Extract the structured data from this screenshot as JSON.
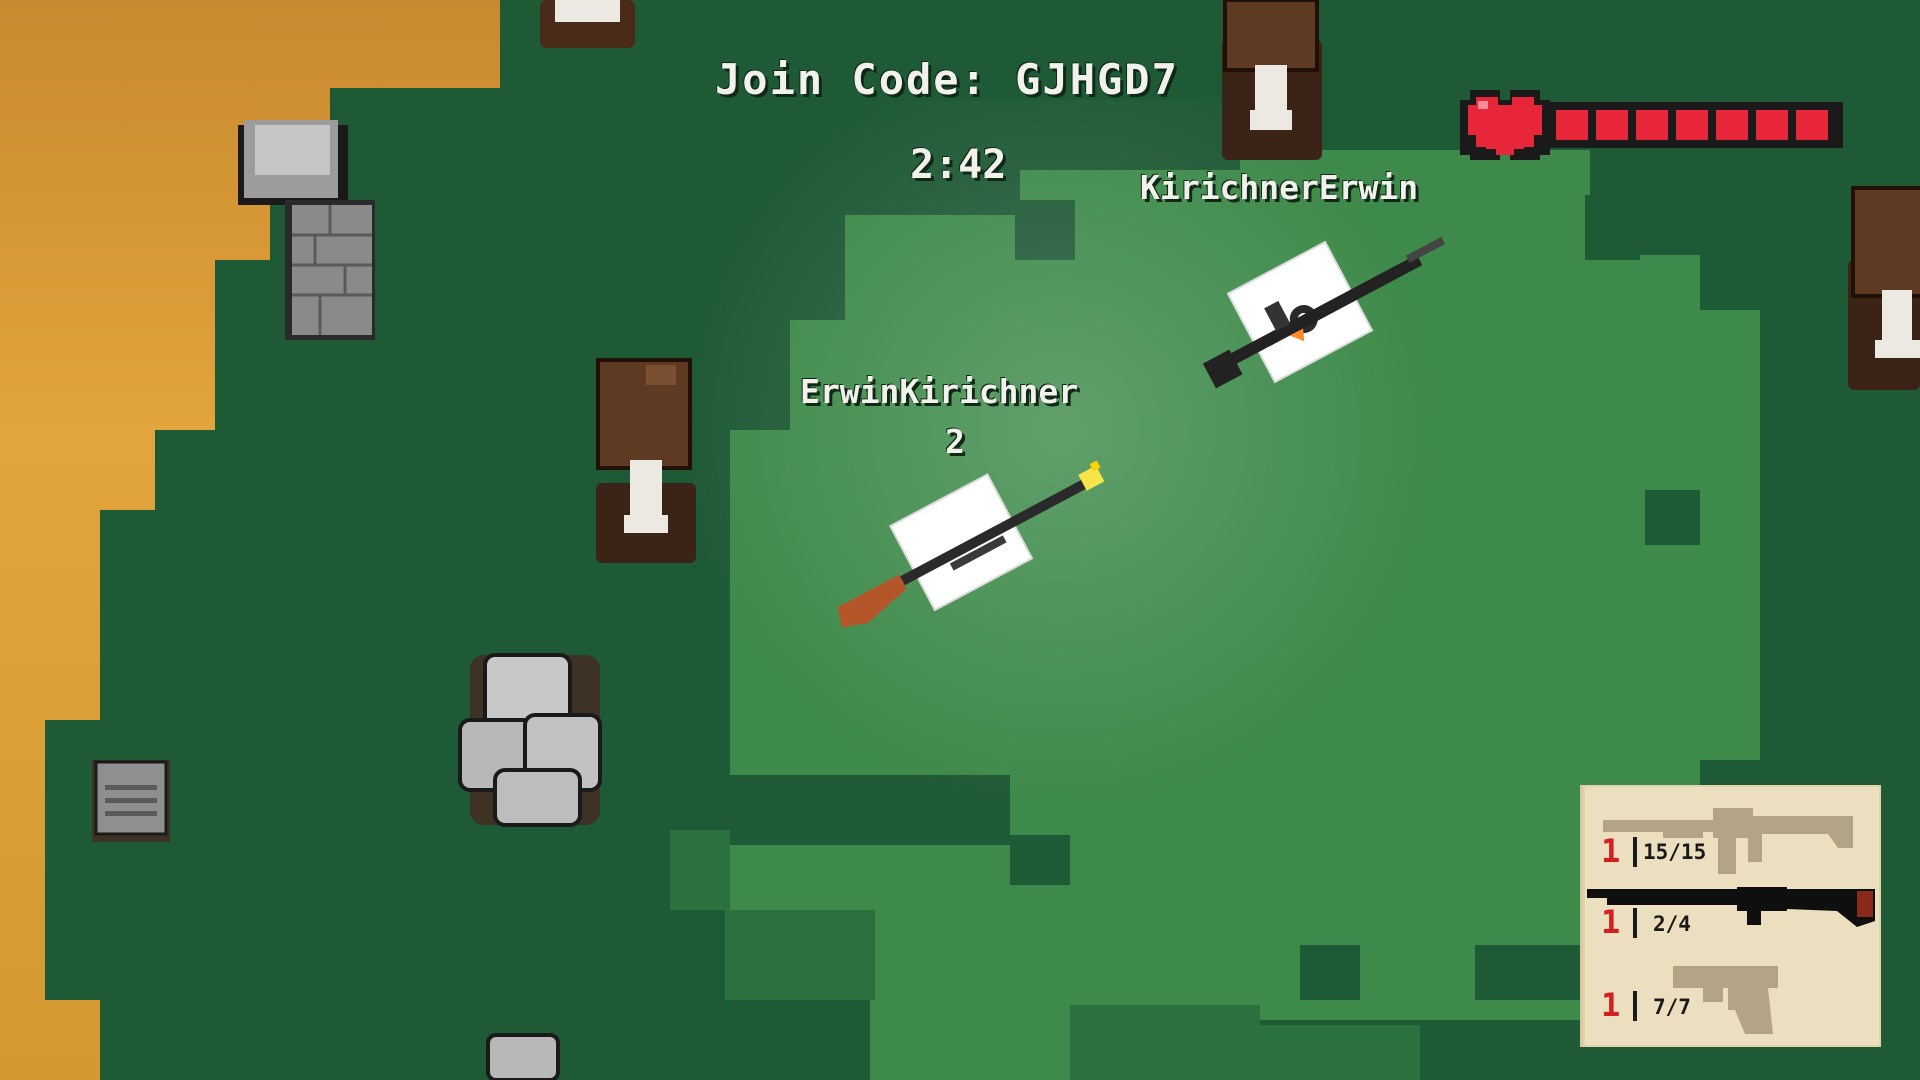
{
  "hud": {
    "join_code": "Join Code: GJHGD7",
    "timer": "2:42",
    "health": {
      "value": 7,
      "max": 7,
      "icon": "heart-icon",
      "color": "#e8263a"
    }
  },
  "players": {
    "enemy": {
      "name": "KirichnerErwin",
      "weapon": "assault-rifle-icon"
    },
    "player": {
      "name": "ErwinKirichner",
      "score": "2",
      "weapon": "shotgun-icon"
    }
  },
  "inventory": {
    "slots": [
      {
        "count": "1",
        "ammo": "15/15",
        "icon": "assault-rifle-icon"
      },
      {
        "count": "1",
        "ammo": "2/4",
        "icon": "shotgun-icon"
      },
      {
        "count": "1",
        "ammo": "7/7",
        "icon": "pistol-icon"
      }
    ]
  },
  "colors": {
    "grass_dark": "#1f5a36",
    "grass_light": "#3c8748",
    "sand": "#e0a13a",
    "panel_bg": "#ecdfbf",
    "count_red": "#d31f1f"
  }
}
